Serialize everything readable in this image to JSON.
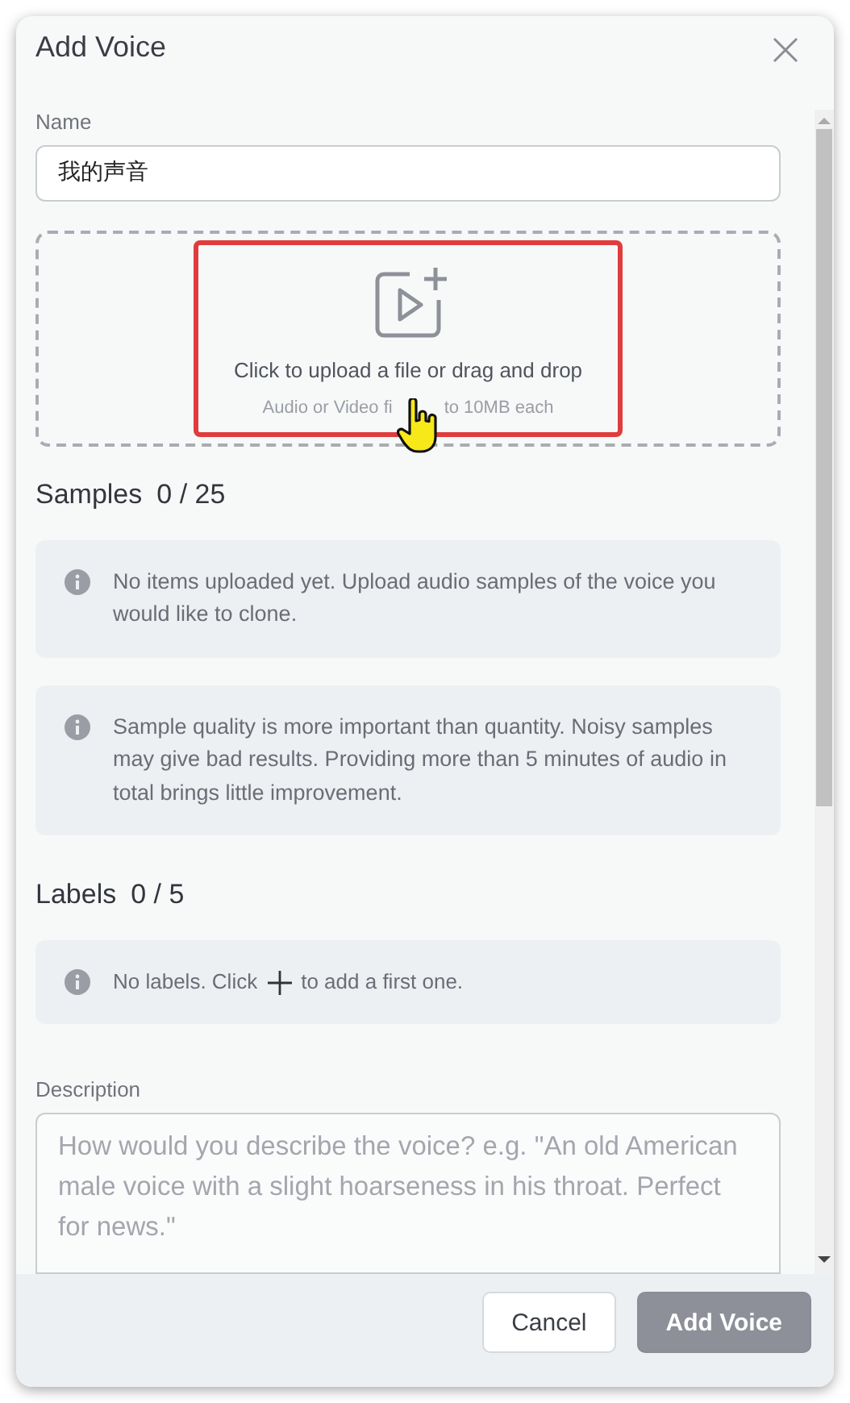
{
  "dialog": {
    "title": "Add Voice"
  },
  "name_field": {
    "label": "Name",
    "value": "我的声音"
  },
  "upload": {
    "prompt": "Click to upload a file or drag and drop",
    "hint_parts": [
      "Audio or Video fi",
      "to 10MB each"
    ],
    "highlighted": true
  },
  "samples": {
    "title": "Samples",
    "count": "0 / 25",
    "notes": [
      "No items uploaded yet. Upload audio samples of the voice you would like to clone.",
      "Sample quality is more important than quantity. Noisy samples may give bad results. Providing more than 5 minutes of audio in total brings little improvement."
    ]
  },
  "labels": {
    "title": "Labels",
    "count": "0 / 5",
    "empty_before": "No labels. Click",
    "empty_after": "to add a first one."
  },
  "description": {
    "label": "Description",
    "placeholder": "How would you describe the voice? e.g. \"An old American male voice with a slight hoarseness in his throat. Perfect for news.\""
  },
  "buttons": [
    {
      "label": "Cancel",
      "kind": "secondary",
      "disabled": false
    },
    {
      "label": "Add Voice",
      "kind": "primary",
      "disabled": true
    }
  ]
}
